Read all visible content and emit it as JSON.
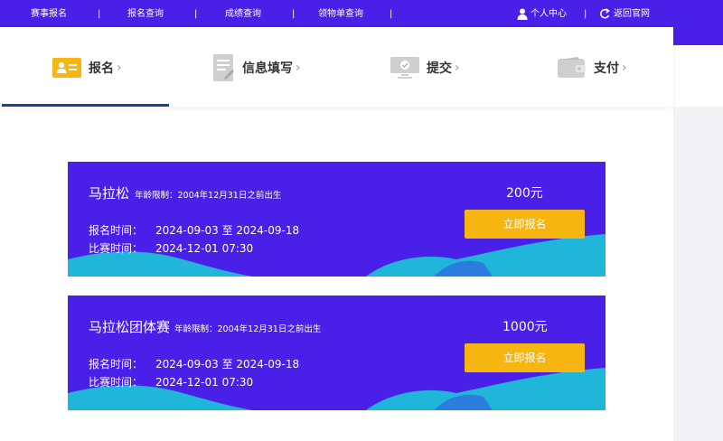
{
  "topnav": {
    "items": [
      "赛事报名",
      "报名查询",
      "成绩查询",
      "领物单查询"
    ],
    "separator": "|",
    "user_center": "个人中心",
    "back_to_site": "返回官网"
  },
  "steps": [
    {
      "label": "报名",
      "chevron": "›"
    },
    {
      "label": "信息填写",
      "chevron": "›"
    },
    {
      "label": "提交",
      "chevron": "›"
    },
    {
      "label": "支付",
      "chevron": "›"
    }
  ],
  "events": [
    {
      "title": "马拉松",
      "age_limit": "年龄限制：2004年12月31日之前出生",
      "reg_label": "报名时间：",
      "reg_value": "2024-09-03 至 2024-09-18",
      "race_label": "比赛时间：",
      "race_value": "2024-12-01 07:30",
      "price": "200元",
      "button": "立即报名"
    },
    {
      "title": "马拉松团体赛",
      "age_limit": "年龄限制：2004年12月31日之前出生",
      "reg_label": "报名时间：",
      "reg_value": "2024-09-03 至 2024-09-18",
      "race_label": "比赛时间：",
      "race_value": "2024-12-01 07:30",
      "price": "1000元",
      "button": "立即报名"
    }
  ],
  "colors": {
    "brand": "#4a1fe8",
    "button": "#f7b512",
    "wave": "#1fb6d9",
    "step_active_icon": "#f7b512",
    "underline": "#203e9a"
  }
}
